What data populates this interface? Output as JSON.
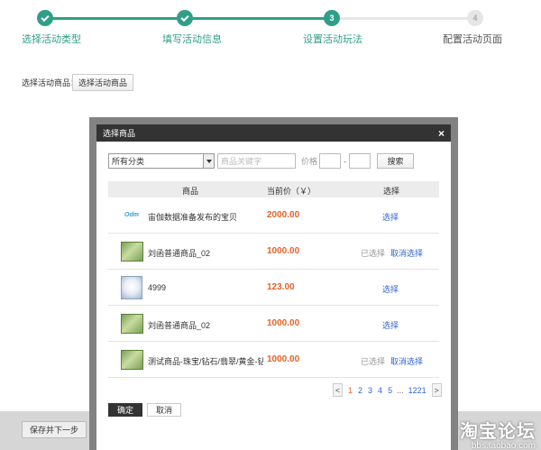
{
  "steps": [
    {
      "label": "选择活动类型",
      "state": "done"
    },
    {
      "label": "填写活动信息",
      "state": "done"
    },
    {
      "label": "设置活动玩法",
      "state": "active",
      "number": "3"
    },
    {
      "label": "配置活动页面",
      "state": "todo",
      "number": "4"
    }
  ],
  "select_goods": {
    "label": "选择活动商品：",
    "button": "选择活动商品"
  },
  "save_button": "保存并下一步",
  "watermark": {
    "big": "淘宝论坛",
    "small": "bbs.taobao.com"
  },
  "modal": {
    "title": "选择商品",
    "close": "×",
    "filter": {
      "category": "所有分类",
      "keyword_placeholder": "商品关键字",
      "price_label": "价格",
      "dash": "-",
      "search_button": "搜索"
    },
    "columns": {
      "goods": "商品",
      "price": "当前价（￥）",
      "select": "选择"
    },
    "rows": [
      {
        "thumb": "logo",
        "logo_text": "Odm",
        "name": "宙伽数据准备发布的宝贝",
        "price": "2000.00",
        "status": "",
        "action": "选择"
      },
      {
        "thumb": "green",
        "name": "刘函普通商品_02",
        "price": "1000.00",
        "status": "已选择",
        "action": "取消选择"
      },
      {
        "thumb": "dog",
        "name": "4999",
        "price": "123.00",
        "status": "",
        "action": "选择"
      },
      {
        "thumb": "green",
        "name": "刘函普通商品_02",
        "price": "1000.00",
        "status": "",
        "action": "选择"
      },
      {
        "thumb": "green",
        "name": "测试商品-珠宝/钻石/翡翠/黄金-钻石",
        "price": "1000.00",
        "status": "已选择",
        "action": "取消选择"
      }
    ],
    "pager": {
      "prev": "<",
      "pages": [
        "1",
        "2",
        "3",
        "4",
        "5"
      ],
      "current": "1",
      "dots": "...",
      "last": "1221",
      "next": ">"
    },
    "ok_button": "确定",
    "cancel_button": "取消"
  },
  "colors": {
    "accent": "#2f9f88",
    "price": "#e2622a",
    "link": "#3366cc"
  }
}
